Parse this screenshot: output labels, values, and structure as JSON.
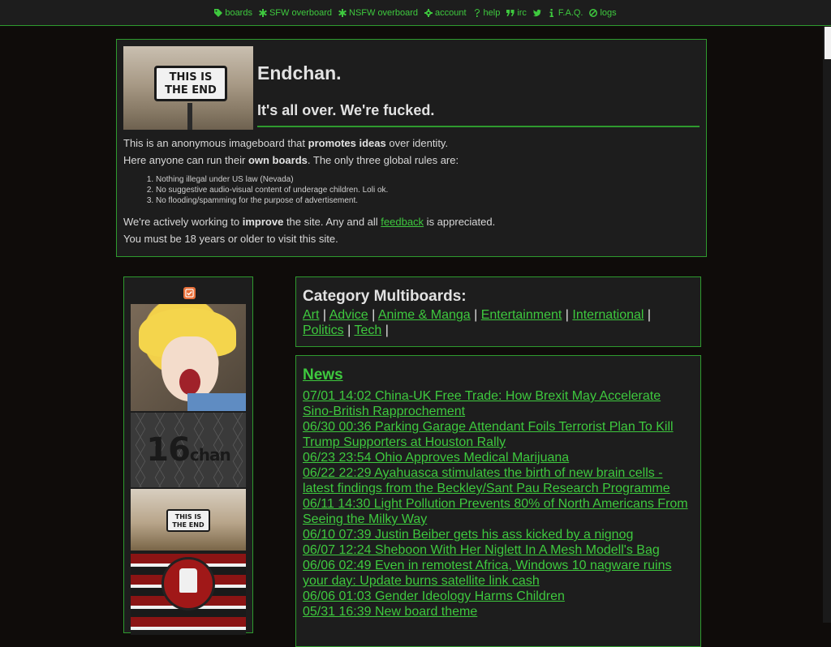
{
  "nav": {
    "items": [
      {
        "icon": "tags-icon",
        "label": "boards"
      },
      {
        "icon": "asterisk-icon",
        "label": "SFW overboard"
      },
      {
        "icon": "asterisk-icon",
        "label": "NSFW overboard"
      },
      {
        "icon": "gear-icon",
        "label": "account"
      },
      {
        "icon": "question-icon",
        "label": "help"
      },
      {
        "icon": "quote-icon",
        "label": "irc"
      },
      {
        "icon": "twitter-icon",
        "label": ""
      },
      {
        "icon": "info-icon",
        "label": "F.A.Q."
      },
      {
        "icon": "ban-icon",
        "label": "logs"
      }
    ]
  },
  "intro": {
    "banner_text": "THIS IS\nTHE END",
    "title": "Endchan.",
    "slogan": "It's all over. We're fucked.",
    "p1_pre": "This is an anonymous imageboard that ",
    "p1_bold": "promotes ideas",
    "p1_post": " over identity.",
    "p2_pre": "Here anyone can run their ",
    "p2_bold": "own boards",
    "p2_post": ". The only three global rules are:",
    "rules": [
      "Nothing illegal under US law (Nevada)",
      "No suggestive audio-visual content of underage children. Loli ok.",
      "No flooding/spamming for the purpose of advertisement."
    ],
    "p3_pre": "We're actively working to ",
    "p3_bold": "improve",
    "p3_mid": " the site. Any and all ",
    "p3_link": "feedback",
    "p3_post": " is appreciated.",
    "p4": "You must be 18 years or older to visit this site."
  },
  "sidebar": {
    "thumb_16chan": "16",
    "thumb_16chan_sub": "chan",
    "thumb_end": "THIS IS\nTHE END"
  },
  "categories": {
    "title": "Category Multiboards:",
    "links": [
      "Art",
      "Advice",
      "Anime & Manga",
      "Entertainment",
      "International",
      "Politics",
      "Tech"
    ]
  },
  "news": {
    "title": "News",
    "items": [
      "07/01 14:02 China-UK Free Trade: How Brexit May Accelerate Sino-British Rapprochement",
      "06/30 00:36 Parking Garage Attendant Foils Terrorist Plan To Kill Trump Supporters at Houston Rally",
      "06/23 23:54 Ohio Approves Medical Marijuana",
      "06/22 22:29 Ayahuasca stimulates the birth of new brain cells - latest findings from the Beckley/Sant Pau Research Programme",
      "06/11 14:30 Light Pollution Prevents 80% of North Americans From Seeing the Milky Way",
      "06/10 07:39 Justin Beiber gets his ass kicked by a nignog",
      "06/07 12:24 Sheboon With Her Niglett In A Mesh Modell's Bag",
      "06/06 02:49 Even in remotest Africa, Windows 10 nagware ruins your day: Update burns satellite link cash",
      "06/06 01:03 Gender Ideology Harms Children",
      "05/31 16:39 New board theme"
    ]
  },
  "colors": {
    "accent": "#3ec93e",
    "background": "#0f0c0a",
    "panel": "#1d1d1d",
    "checkbox": "#e8703a"
  }
}
